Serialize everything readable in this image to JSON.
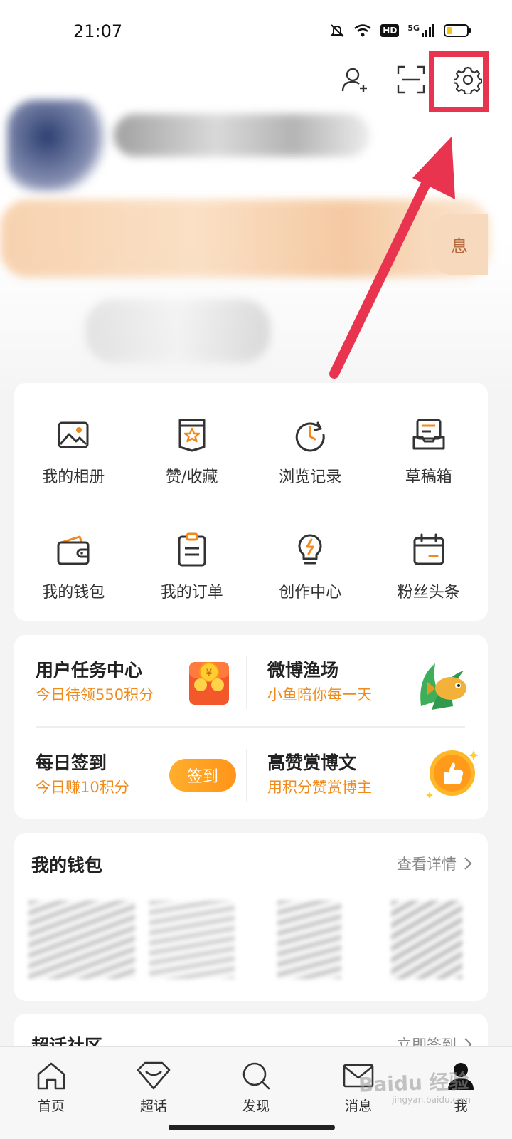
{
  "status_bar": {
    "time": "21:07",
    "hd_label": "HD",
    "network_label": "5G"
  },
  "header": {
    "icons": [
      "add-friend-icon",
      "scan-icon",
      "settings-icon"
    ],
    "profile_pill_text": "息"
  },
  "menu_grid": {
    "items": [
      {
        "label": "我的相册",
        "icon": "photo-album-icon"
      },
      {
        "label": "赞/收藏",
        "icon": "favorites-icon"
      },
      {
        "label": "浏览记录",
        "icon": "history-icon"
      },
      {
        "label": "草稿箱",
        "icon": "drafts-icon"
      },
      {
        "label": "我的钱包",
        "icon": "wallet-icon"
      },
      {
        "label": "我的订单",
        "icon": "orders-icon"
      },
      {
        "label": "创作中心",
        "icon": "creator-center-icon"
      },
      {
        "label": "粉丝头条",
        "icon": "fans-headline-icon"
      }
    ]
  },
  "tasks": {
    "task_center": {
      "title": "用户任务中心",
      "subtitle": "今日待领550积分"
    },
    "fishing": {
      "title": "微博渔场",
      "subtitle": "小鱼陪你每一天"
    },
    "checkin": {
      "title": "每日签到",
      "subtitle": "今日赚10积分",
      "button": "签到"
    },
    "reward": {
      "title": "高赞赏博文",
      "subtitle": "用积分赞赏博主"
    }
  },
  "wallet": {
    "title": "我的钱包",
    "link": "查看详情"
  },
  "super_topic": {
    "title": "超话社区",
    "link": "立即签到"
  },
  "tabbar": {
    "tabs": [
      {
        "label": "首页",
        "icon": "home-icon"
      },
      {
        "label": "超话",
        "icon": "super-topic-icon"
      },
      {
        "label": "发现",
        "icon": "discover-icon"
      },
      {
        "label": "消息",
        "icon": "messages-icon"
      },
      {
        "label": "我",
        "icon": "me-icon"
      }
    ]
  },
  "watermark": {
    "text": "Baidu 经验",
    "url": "jingyan.baidu.com"
  },
  "colors": {
    "accent_orange": "#f08a1b",
    "highlight_red": "#e8344f"
  }
}
